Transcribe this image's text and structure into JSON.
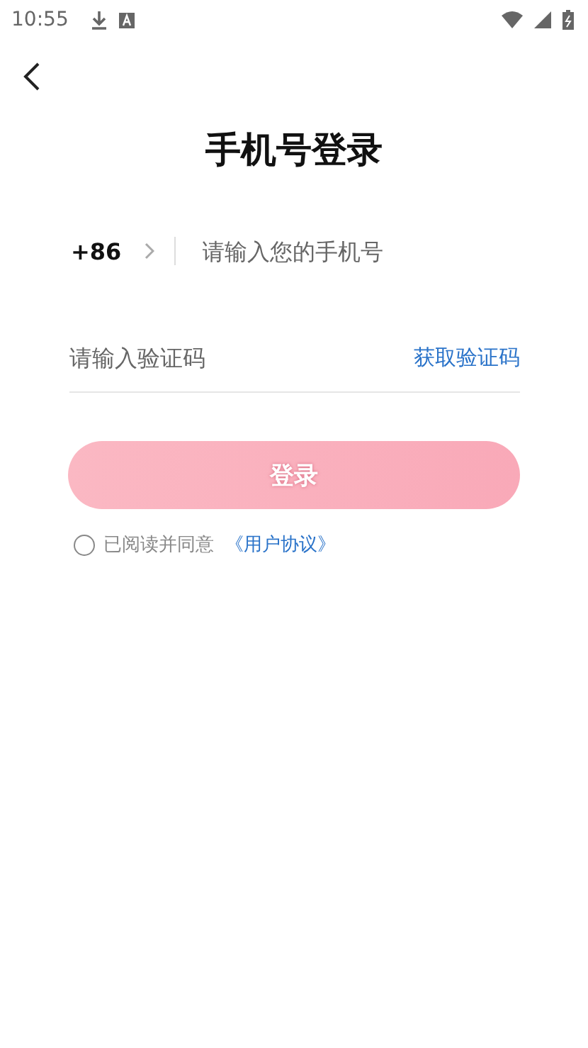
{
  "status_bar": {
    "time": "10:55"
  },
  "title": "手机号登录",
  "phone": {
    "country_code": "+86",
    "placeholder": "请输入您的手机号"
  },
  "code": {
    "placeholder": "请输入验证码",
    "action": "获取验证码"
  },
  "login_button": {
    "label": "登录",
    "disabled": true
  },
  "agreement": {
    "checked": false,
    "text": "已阅读并同意",
    "link": "《用户协议》"
  }
}
